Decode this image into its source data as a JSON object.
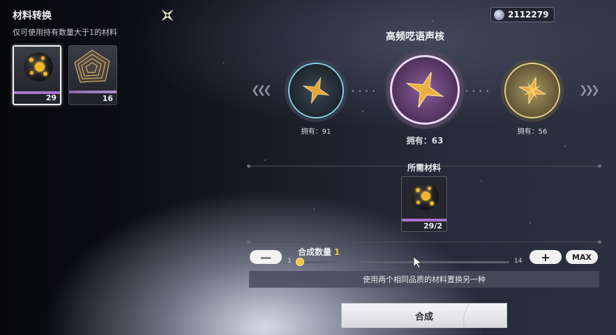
{
  "panel": {
    "title": "材料转换",
    "hint": "仅可使用持有数量大于1的材料"
  },
  "inventory": [
    {
      "name": "orb-material",
      "count": "29",
      "selected": true
    },
    {
      "name": "spiral-material",
      "count": "16",
      "selected": false
    }
  ],
  "currency": {
    "value": "2112279",
    "icon": "crystal-icon"
  },
  "target": {
    "title": "高频呓语声核",
    "options": [
      {
        "owned": "拥有：91",
        "tier": "teal"
      },
      {
        "owned": "拥有：63",
        "tier": "purple",
        "selected": true
      },
      {
        "owned": "拥有：56",
        "tier": "gold"
      }
    ]
  },
  "required": {
    "title": "所需材料",
    "count": "29/2"
  },
  "quantity": {
    "label": "合成数量",
    "value": "1",
    "min": "1",
    "max": "14",
    "max_button": "MAX",
    "minus_button": "—",
    "plus_button": "+",
    "fraction": 0.0
  },
  "description": "使用两个相同品质的材料置换另一种",
  "synth_button": "合成",
  "colors": {
    "accent_gold": "#f0c43c",
    "rarity_purple": "#a972d4",
    "ring_teal": "#7fd0dd",
    "ring_gold": "#e7cf87"
  }
}
